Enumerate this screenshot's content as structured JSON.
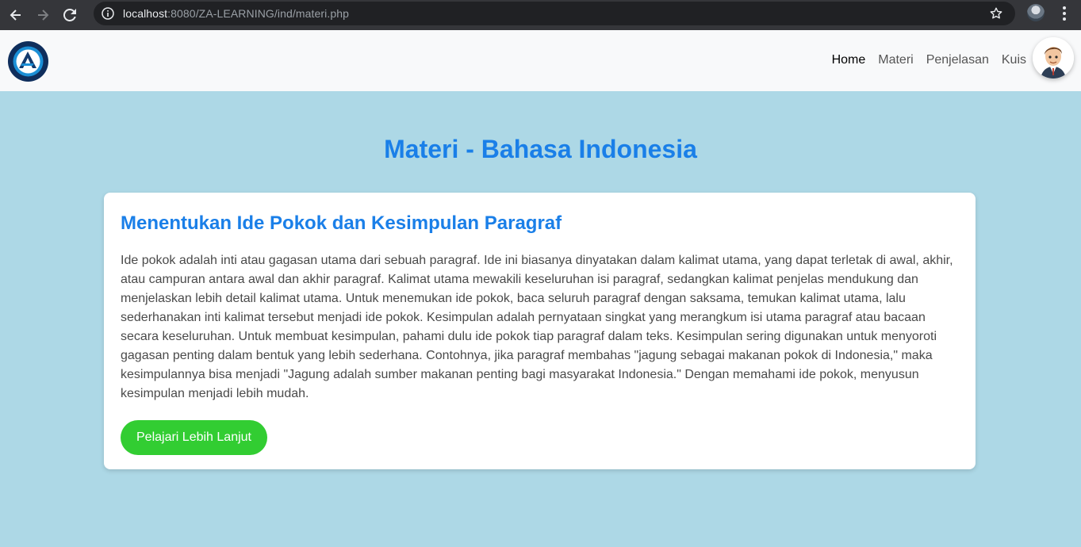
{
  "browser": {
    "url_host": "localhost",
    "url_path": ":8080/ZA-LEARNING/ind/materi.php"
  },
  "nav": {
    "items": [
      {
        "label": "Home",
        "active": true
      },
      {
        "label": "Materi",
        "active": false
      },
      {
        "label": "Penjelasan",
        "active": false
      },
      {
        "label": "Kuis",
        "active": false
      }
    ]
  },
  "page": {
    "title": "Materi - Bahasa Indonesia"
  },
  "card": {
    "title": "Menentukan Ide Pokok dan Kesimpulan Paragraf",
    "body": "Ide pokok adalah inti atau gagasan utama dari sebuah paragraf. Ide ini biasanya dinyatakan dalam kalimat utama, yang dapat terletak di awal, akhir, atau campuran antara awal dan akhir paragraf. Kalimat utama mewakili keseluruhan isi paragraf, sedangkan kalimat penjelas mendukung dan menjelaskan lebih detail kalimat utama. Untuk menemukan ide pokok, baca seluruh paragraf dengan saksama, temukan kalimat utama, lalu sederhanakan inti kalimat tersebut menjadi ide pokok. Kesimpulan adalah pernyataan singkat yang merangkum isi utama paragraf atau bacaan secara keseluruhan. Untuk membuat kesimpulan, pahami dulu ide pokok tiap paragraf dalam teks. Kesimpulan sering digunakan untuk menyoroti gagasan penting dalam bentuk yang lebih sederhana. Contohnya, jika paragraf membahas \"jagung sebagai makanan pokok di Indonesia,\" maka kesimpulannya bisa menjadi \"Jagung adalah sumber makanan penting bagi masyarakat Indonesia.\" Dengan memahami ide pokok, menyusun kesimpulan menjadi lebih mudah.",
    "button_label": "Pelajari Lebih Lanjut"
  },
  "colors": {
    "background": "#add8e6",
    "accent_blue": "#1a7fe8",
    "button_green": "#32cd32"
  },
  "icons": [
    "back-icon",
    "forward-icon",
    "reload-icon",
    "site-info-icon",
    "bookmark-star-icon",
    "profile-icon",
    "browser-menu-icon",
    "site-logo",
    "user-avatar"
  ]
}
